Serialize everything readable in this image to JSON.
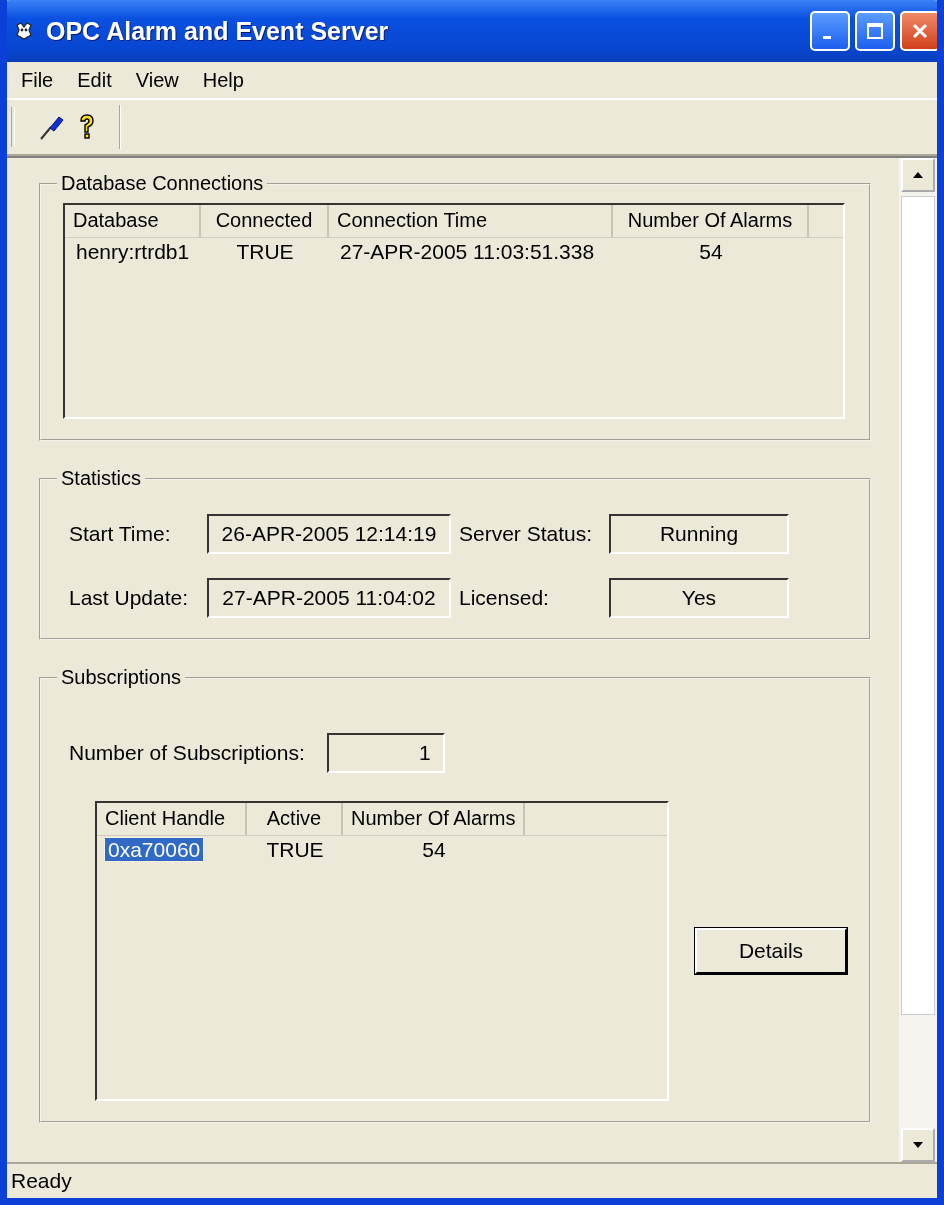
{
  "window": {
    "title": "OPC Alarm and Event Server"
  },
  "menu": [
    "File",
    "Edit",
    "View",
    "Help"
  ],
  "database_connections": {
    "title": "Database Connections",
    "columns": [
      "Database",
      "Connected",
      "Connection Time",
      "Number Of Alarms"
    ],
    "rows": [
      {
        "cells": [
          "henry:rtrdb1",
          "TRUE",
          "27-APR-2005 11:03:51.338",
          "54"
        ],
        "selected": false
      }
    ]
  },
  "statistics": {
    "title": "Statistics",
    "fields": [
      {
        "label": "Start Time:",
        "value": "26-APR-2005 12:14:19"
      },
      {
        "label": "Server Status:",
        "value": "Running"
      },
      {
        "label": "Last Update:",
        "value": "27-APR-2005 11:04:02"
      },
      {
        "label": "Licensed:",
        "value": "Yes"
      }
    ]
  },
  "subscriptions": {
    "title": "Subscriptions",
    "count_label": "Number of Subscriptions:",
    "count": "1",
    "columns": [
      "Client Handle",
      "Active",
      "Number Of Alarms"
    ],
    "rows": [
      {
        "cells": [
          "0xa70060",
          "TRUE",
          "54"
        ],
        "selected": true
      }
    ],
    "button": "Details"
  },
  "status_bar": "Ready"
}
